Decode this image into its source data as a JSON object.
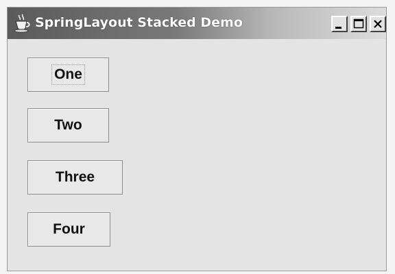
{
  "window": {
    "title": "SpringLayout Stacked Demo",
    "app_icon": "java-cup-icon",
    "controls": {
      "minimize": "minimize-icon",
      "maximize": "maximize-icon",
      "close": "close-icon"
    }
  },
  "buttons": [
    {
      "label": "One",
      "focused": true
    },
    {
      "label": "Two",
      "focused": false
    },
    {
      "label": "Three",
      "focused": false
    },
    {
      "label": "Four",
      "focused": false
    }
  ],
  "colors": {
    "titlebar_start": "#5a5a5a",
    "titlebar_end": "#dcdcdc",
    "content_bg": "#e4e4e4",
    "button_bg": "#e8e8e8"
  }
}
